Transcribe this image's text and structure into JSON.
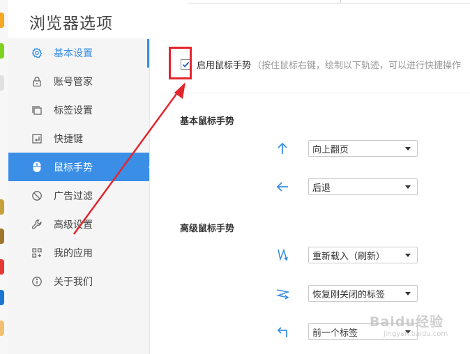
{
  "window": {
    "title": "浏览器选项"
  },
  "sidebar": {
    "items": [
      {
        "label": "基本设置",
        "icon": "gear-icon"
      },
      {
        "label": "账号管家",
        "icon": "lock-icon"
      },
      {
        "label": "标签设置",
        "icon": "tabs-icon"
      },
      {
        "label": "快捷键",
        "icon": "shortcut-key-icon"
      },
      {
        "label": "鼠标手势",
        "icon": "mouse-icon"
      },
      {
        "label": "广告过滤",
        "icon": "block-icon"
      },
      {
        "label": "高级设置",
        "icon": "wrench-icon"
      },
      {
        "label": "我的应用",
        "icon": "apps-icon"
      },
      {
        "label": "关于我们",
        "icon": "info-icon"
      }
    ],
    "active_index": 4
  },
  "mouse_gesture": {
    "enable_checked": true,
    "enable_label": "启用鼠标手势",
    "enable_hint": "（按住鼠标右键，绘制以下轨迹，可以进行快捷操作",
    "basic_title": "基本鼠标手势",
    "advanced_title": "高级鼠标手势",
    "basic": [
      {
        "icon": "arrow-up-icon",
        "value": "向上翻页"
      },
      {
        "icon": "arrow-left-icon",
        "value": "后退"
      }
    ],
    "advanced": [
      {
        "icon": "gesture-down-up-down-icon",
        "value": "重新载入（刷新）"
      },
      {
        "icon": "gesture-right-left-right-icon",
        "value": "恢复刚关闭的标签"
      },
      {
        "icon": "gesture-up-left-icon",
        "value": "前一个标签"
      }
    ]
  },
  "watermark": {
    "text": "Baidu经验",
    "sub": "jingyan.baidu.com"
  },
  "colors": {
    "accent": "#3a8ee6",
    "annotation": "#e3262d"
  }
}
